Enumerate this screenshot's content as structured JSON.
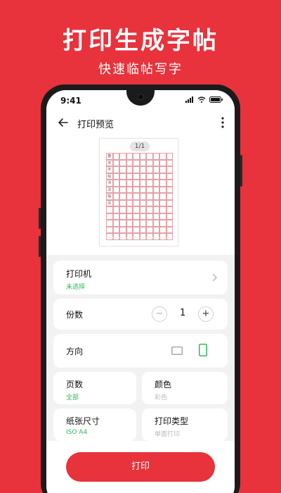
{
  "promo": {
    "headline": "打印生成字帖",
    "subline": "快速临帖写字"
  },
  "status": {
    "time": "9:41"
  },
  "appbar": {
    "title": "打印预览"
  },
  "preview": {
    "pager": "1/1",
    "sheet_first_col": [
      "春",
      "天",
      "字",
      "帖",
      "书",
      "法",
      "临",
      "写",
      "",
      "",
      "",
      "",
      ""
    ]
  },
  "printer": {
    "label": "打印机",
    "value": "未选择"
  },
  "copies": {
    "label": "份数",
    "minus": "−",
    "count": "1",
    "plus": "+"
  },
  "orientation": {
    "label": "方向",
    "selected": "portrait"
  },
  "pages": {
    "label": "页数",
    "value": "全部"
  },
  "color": {
    "label": "颜色",
    "value": "彩色"
  },
  "paper_size": {
    "label": "纸张尺寸",
    "value": "ISO A4"
  },
  "print_type": {
    "label": "打印类型",
    "value": "单面打印"
  },
  "actions": {
    "print_label": "打印"
  },
  "colors": {
    "brand": "#e8323c",
    "accent_green": "#2fb85a"
  }
}
